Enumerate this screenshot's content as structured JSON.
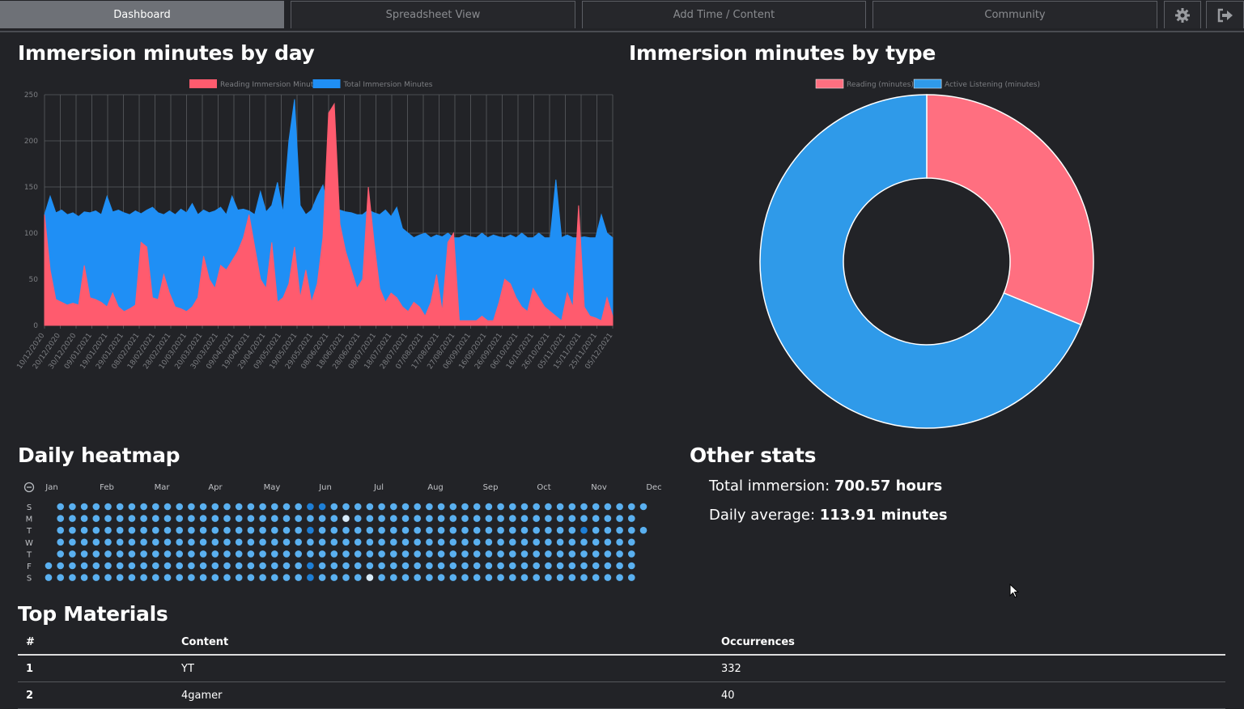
{
  "tabs": [
    {
      "label": "Dashboard",
      "active": true
    },
    {
      "label": "Spreadsheet View",
      "active": false
    },
    {
      "label": "Add Time / Content",
      "active": false
    },
    {
      "label": "Community",
      "active": false
    }
  ],
  "icons": {
    "settings": "gear-icon",
    "logout": "logout-icon"
  },
  "sections": {
    "by_day": "Immersion minutes by day",
    "by_type": "Immersion minutes by type",
    "heatmap": "Daily heatmap",
    "other": "Other stats",
    "top": "Top Materials"
  },
  "chart_data": [
    {
      "type": "area",
      "legend_position": "top",
      "grid": true,
      "ylim": [
        0,
        250
      ],
      "yticks": [
        0,
        50,
        100,
        150,
        200,
        250
      ],
      "x_tick_labels": [
        "10/12/2020",
        "20/12/2020",
        "30/12/2020",
        "09/01/2021",
        "19/01/2021",
        "29/01/2021",
        "08/02/2021",
        "18/02/2021",
        "28/02/2021",
        "10/03/2021",
        "20/03/2021",
        "30/03/2021",
        "09/04/2021",
        "19/04/2021",
        "29/04/2021",
        "09/05/2021",
        "19/05/2021",
        "29/05/2021",
        "08/06/2021",
        "18/06/2021",
        "28/06/2021",
        "08/07/2021",
        "18/07/2021",
        "28/07/2021",
        "07/08/2021",
        "17/08/2021",
        "27/08/2021",
        "06/09/2021",
        "16/09/2021",
        "26/09/2021",
        "06/10/2021",
        "16/10/2021",
        "26/10/2021",
        "05/11/2021",
        "15/11/2021",
        "25/11/2021",
        "05/12/2021"
      ],
      "series": [
        {
          "name": "Reading Immersion Minutes",
          "color": "#ff5b6e",
          "values": [
            120,
            60,
            28,
            25,
            22,
            24,
            22,
            65,
            30,
            28,
            25,
            20,
            35,
            20,
            15,
            18,
            22,
            90,
            85,
            30,
            28,
            55,
            35,
            20,
            18,
            15,
            20,
            30,
            75,
            50,
            40,
            65,
            60,
            70,
            80,
            95,
            120,
            85,
            50,
            40,
            90,
            25,
            30,
            45,
            85,
            30,
            60,
            25,
            45,
            95,
            230,
            240,
            110,
            80,
            60,
            40,
            50,
            150,
            90,
            40,
            25,
            35,
            30,
            20,
            15,
            25,
            20,
            10,
            25,
            55,
            15,
            90,
            100,
            5,
            5,
            5,
            5,
            10,
            5,
            5,
            25,
            50,
            45,
            30,
            20,
            15,
            40,
            30,
            20,
            15,
            10,
            5,
            35,
            20,
            130,
            20,
            10,
            8,
            5,
            30,
            10
          ]
        },
        {
          "name": "Total Immersion Minutes",
          "color": "#1f8ff5",
          "values": [
            120,
            140,
            122,
            125,
            120,
            122,
            118,
            123,
            122,
            124,
            120,
            140,
            123,
            125,
            122,
            120,
            124,
            121,
            125,
            128,
            122,
            120,
            124,
            120,
            126,
            122,
            132,
            120,
            125,
            122,
            124,
            128,
            120,
            140,
            125,
            126,
            124,
            120,
            145,
            123,
            130,
            155,
            122,
            200,
            245,
            130,
            120,
            125,
            140,
            152,
            125,
            120,
            125,
            123,
            122,
            120,
            120,
            125,
            122,
            120,
            125,
            118,
            128,
            105,
            100,
            95,
            98,
            100,
            95,
            98,
            96,
            100,
            95,
            95,
            98,
            96,
            95,
            100,
            95,
            98,
            96,
            95,
            98,
            95,
            100,
            95,
            95,
            100,
            95,
            95,
            158,
            95,
            98,
            95,
            95,
            96,
            95,
            95,
            120,
            100,
            95
          ]
        }
      ]
    },
    {
      "type": "pie",
      "legend_position": "top",
      "labels": [
        "Reading (minutes)",
        "Active Listening (minutes)"
      ],
      "values": [
        31.2,
        68.8
      ],
      "colors": [
        "#ff6f80",
        "#2f9ae9"
      ]
    }
  ],
  "heatmap": {
    "months": [
      "Jan",
      "Feb",
      "Mar",
      "Apr",
      "May",
      "Jun",
      "Jul",
      "Aug",
      "Sep",
      "Oct",
      "Nov",
      "Dec"
    ],
    "days": [
      "S",
      "M",
      "T",
      "W",
      "T",
      "F",
      "S"
    ],
    "colors": {
      "normal": "#5ab0f0",
      "dark": "#1e7fd6",
      "light": "#d8ecfb"
    }
  },
  "stats": {
    "total_label": "Total immersion:",
    "total_value": "700.57 hours",
    "avg_label": "Daily average:",
    "avg_value": "113.91 minutes"
  },
  "table": {
    "headers": [
      "#",
      "Content",
      "Occurrences"
    ],
    "rows": [
      [
        "1",
        "YT",
        "332"
      ],
      [
        "2",
        "4gamer",
        "40"
      ]
    ]
  }
}
